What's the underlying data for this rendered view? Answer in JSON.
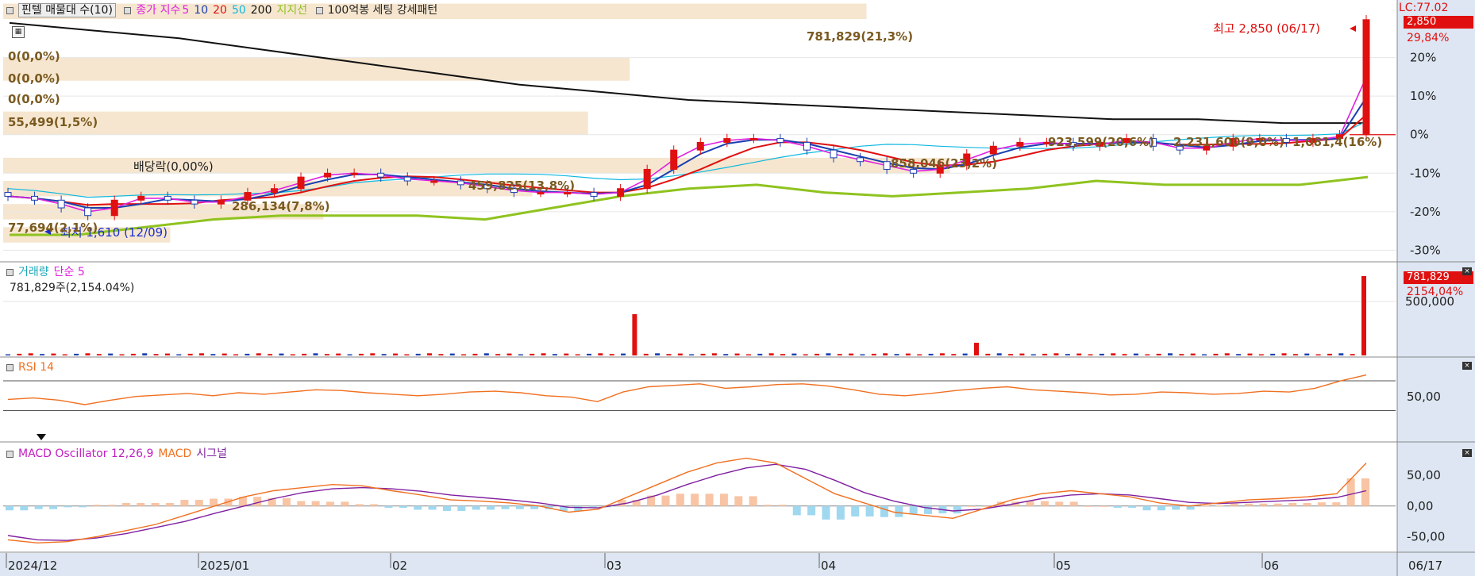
{
  "legends": {
    "price": {
      "stock": "핀텔 매물대 수(10)",
      "ma_label": "종가 지수",
      "ma5": "5",
      "ma10": "10",
      "ma20": "20",
      "ma50": "50",
      "ma200": "200",
      "support": "지지선",
      "pattern": "100억봉 세팅 강세패턴"
    },
    "volume": {
      "title": "거래량",
      "ma": "단순 5",
      "info": "781,829주(2,154.04%)"
    },
    "rsi": {
      "title": "RSI 14"
    },
    "macd": {
      "osc": "MACD Oscillator 12,26,9",
      "macd": "MACD",
      "signal": "시그널"
    }
  },
  "annotations": {
    "high": "최고 2,850 (06/17)",
    "low": "최저 1,610 (12/09)",
    "dividend": "배당락(0,00%)",
    "lc": "LC:77.02"
  },
  "right_tags": {
    "price": "2,850",
    "price_pct": "29,84%",
    "volume": "781,829",
    "volume_pct": "2154,04%"
  },
  "volume_profile": [
    {
      "label": "781,829(21,3%)"
    },
    {
      "label": "0(0,0%)"
    },
    {
      "label": "0(0,0%)"
    },
    {
      "label": "0(0,0%)"
    },
    {
      "label": "55,499(1,5%)"
    },
    {
      "label": "923,599(20,6%)"
    },
    {
      "label": "2,231,600(9,0%)"
    },
    {
      "label": "1,081,4(16%)"
    },
    {
      "label": "858,046(23,2%)"
    },
    {
      "label": "459,825(13,8%)"
    },
    {
      "label": "286,134(7,8%)"
    },
    {
      "label": "77,694(2,1%)"
    }
  ],
  "chart_data": [
    {
      "type": "candlestick",
      "title": "핀텔 매물대 수(10)",
      "x_ticks": [
        "2024/12",
        "2025/01",
        "02",
        "03",
        "04",
        "05",
        "06",
        "06/17"
      ],
      "y_ticks": [
        "20%",
        "10%",
        "0%",
        "-10%",
        "-20%",
        "-30%"
      ],
      "ylim_pct": [
        -33,
        30
      ],
      "series_approx_pct_change": {
        "close_keypoints": [
          -16,
          -17,
          -19,
          -21,
          -17,
          -16,
          -17,
          -18,
          -17,
          -15,
          -14,
          -11,
          -10,
          -10,
          -11,
          -12,
          -12,
          -13,
          -14,
          -15,
          -15,
          -15,
          -16,
          -14,
          -9,
          -4,
          -2,
          -1,
          -1,
          -2,
          -4,
          -6,
          -7,
          -9,
          -10,
          -8,
          -5,
          -3,
          -2,
          -2,
          -3,
          -2,
          -1,
          -3,
          -4,
          -3,
          -1,
          -1,
          -2,
          -1,
          0,
          29.84
        ],
        "ma200": [
          29,
          27,
          25,
          22,
          19,
          16,
          13,
          11,
          9,
          8,
          7,
          6,
          5,
          4,
          4,
          3,
          3
        ],
        "support": [
          -26,
          -26,
          -24,
          -22,
          -21,
          -21,
          -21,
          -22,
          -19,
          -16,
          -14,
          -13,
          -15,
          -16,
          -15,
          -14,
          -12,
          -13,
          -13,
          -13,
          -11
        ]
      },
      "high": {
        "value": 2850,
        "date": "06/17"
      },
      "low": {
        "value": 1610,
        "date": "12/09"
      }
    },
    {
      "type": "bar",
      "title": "거래량",
      "y_ticks": [
        "500,000"
      ],
      "last_value": 781829,
      "spikes": [
        {
          "month": "03",
          "relative": 0.52
        },
        {
          "month": "04",
          "relative": 0.16
        },
        {
          "month": "06/17",
          "relative": 1.0
        }
      ]
    },
    {
      "type": "line",
      "title": "RSI 14",
      "y_ticks": [
        "50,00"
      ],
      "values": [
        45,
        47,
        44,
        38,
        44,
        49,
        51,
        53,
        50,
        54,
        52,
        55,
        58,
        57,
        54,
        52,
        50,
        52,
        55,
        56,
        54,
        50,
        48,
        42,
        55,
        62,
        64,
        66,
        60,
        62,
        65,
        66,
        63,
        58,
        52,
        50,
        53,
        57,
        60,
        62,
        58,
        56,
        54,
        51,
        52,
        55,
        54,
        52,
        53,
        56,
        55,
        60,
        70,
        78
      ]
    },
    {
      "type": "line",
      "title": "MACD Oscillator 12,26,9",
      "y_ticks": [
        "50,00",
        "0,00",
        "-50,00"
      ],
      "ylim": [
        -70,
        85
      ],
      "macd": [
        -55,
        -60,
        -58,
        -50,
        -40,
        -30,
        -15,
        0,
        15,
        25,
        30,
        35,
        33,
        25,
        18,
        10,
        8,
        5,
        0,
        -10,
        -5,
        15,
        35,
        55,
        70,
        78,
        70,
        45,
        20,
        5,
        -10,
        -15,
        -20,
        -5,
        10,
        20,
        25,
        20,
        15,
        5,
        0,
        5,
        10,
        12,
        15,
        20,
        70
      ],
      "signal": [
        -48,
        -55,
        -56,
        -52,
        -45,
        -35,
        -25,
        -12,
        0,
        12,
        22,
        28,
        30,
        28,
        24,
        18,
        14,
        10,
        5,
        -2,
        -3,
        5,
        18,
        35,
        50,
        62,
        68,
        60,
        42,
        22,
        8,
        -2,
        -8,
        -5,
        3,
        12,
        18,
        20,
        18,
        12,
        6,
        4,
        6,
        8,
        10,
        14,
        25
      ],
      "oscillator": [
        -7,
        -5,
        -2,
        2,
        5,
        5,
        10,
        12,
        15,
        13,
        8,
        7,
        3,
        -3,
        -6,
        -8,
        -6,
        -5,
        -5,
        -8,
        -2,
        10,
        17,
        20,
        20,
        16,
        2,
        -15,
        -22,
        -17,
        -18,
        -13,
        -12,
        0,
        7,
        8,
        7,
        0,
        -3,
        -7,
        -6,
        1,
        4,
        4,
        5,
        6,
        45
      ]
    }
  ]
}
